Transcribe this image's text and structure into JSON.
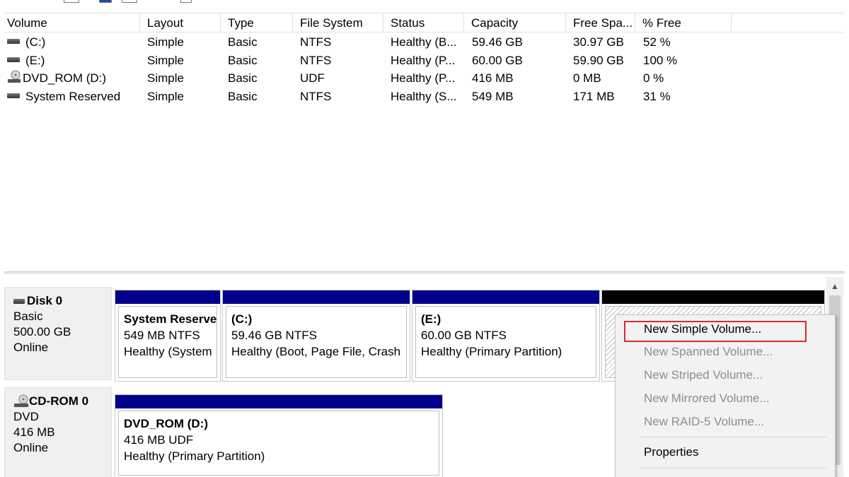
{
  "volume_list": {
    "columns": [
      "Volume",
      "Layout",
      "Type",
      "File System",
      "Status",
      "Capacity",
      "Free Spa...",
      "% Free"
    ],
    "rows": [
      {
        "icon": "drive-icon",
        "volume": "(C:)",
        "layout": "Simple",
        "type": "Basic",
        "fs": "NTFS",
        "status": "Healthy (B...",
        "capacity": "59.46 GB",
        "free": "30.97 GB",
        "pct": "52 %"
      },
      {
        "icon": "drive-icon",
        "volume": "(E:)",
        "layout": "Simple",
        "type": "Basic",
        "fs": "NTFS",
        "status": "Healthy (P...",
        "capacity": "60.00 GB",
        "free": "59.90 GB",
        "pct": "100 %"
      },
      {
        "icon": "dvd-icon",
        "volume": "DVD_ROM (D:)",
        "layout": "Simple",
        "type": "Basic",
        "fs": "UDF",
        "status": "Healthy (P...",
        "capacity": "416 MB",
        "free": "0 MB",
        "pct": "0 %"
      },
      {
        "icon": "drive-icon",
        "volume": "System Reserved",
        "layout": "Simple",
        "type": "Basic",
        "fs": "NTFS",
        "status": "Healthy (S...",
        "capacity": "549 MB",
        "free": "171 MB",
        "pct": "31 %"
      }
    ]
  },
  "disks": [
    {
      "name": "Disk 0",
      "type": "Basic",
      "size": "500.00 GB",
      "state": "Online",
      "partitions": [
        {
          "name": "System Reserve",
          "size": "549 MB NTFS",
          "status": "Healthy (System"
        },
        {
          "name": "(C:)",
          "size": "59.46 GB NTFS",
          "status": "Healthy (Boot, Page File, Crash"
        },
        {
          "name": "(E:)",
          "size": "60.00 GB NTFS",
          "status": "Healthy (Primary Partition)"
        }
      ]
    },
    {
      "name": "CD-ROM 0",
      "type": "DVD",
      "size": "416 MB",
      "state": "Online",
      "partitions": [
        {
          "name": "DVD_ROM  (D:)",
          "size": "416 MB UDF",
          "status": "Healthy (Primary Partition)"
        }
      ]
    }
  ],
  "context_menu": {
    "items": [
      {
        "label": "New Simple Volume...",
        "enabled": true
      },
      {
        "label": "New Spanned Volume...",
        "enabled": false
      },
      {
        "label": "New Striped Volume...",
        "enabled": false
      },
      {
        "label": "New Mirrored Volume...",
        "enabled": false
      },
      {
        "label": "New RAID-5 Volume...",
        "enabled": false
      },
      {
        "label": "Properties",
        "enabled": true
      }
    ]
  },
  "colors": {
    "partition_bar": "#00008b",
    "unallocated_bar": "#000000",
    "highlight": "#e0262b"
  }
}
